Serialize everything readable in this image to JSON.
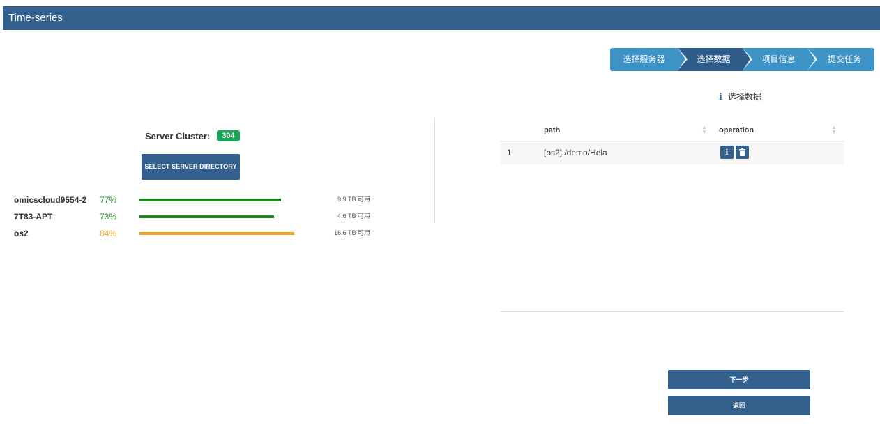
{
  "window": {
    "title": "Time-series"
  },
  "steps": [
    {
      "label": "选择服务器",
      "active": false
    },
    {
      "label": "选择数据",
      "active": true
    },
    {
      "label": "项目信息",
      "active": false
    },
    {
      "label": "提交任务",
      "active": false
    }
  ],
  "hint": {
    "icon": "info-icon",
    "text": "选择数据"
  },
  "cluster": {
    "label": "Server Cluster:",
    "count": "304",
    "badge_color": "#18a55a"
  },
  "select_button": {
    "label": "SELECT SERVER DIRECTORY"
  },
  "servers": [
    {
      "name": "omicscloud9554-2",
      "percent": "77%",
      "usage": 0.77,
      "available": "9.9 TB 可用",
      "color": "#1a8a1a"
    },
    {
      "name": "7T83-APT",
      "percent": "73%",
      "usage": 0.73,
      "available": "4.6 TB 可用",
      "color": "#1a8a1a"
    },
    {
      "name": "os2",
      "percent": "84%",
      "usage": 0.84,
      "available": "16.6 TB 可用",
      "color": "#f5a623"
    }
  ],
  "table": {
    "columns": [
      "path",
      "operation"
    ],
    "rows": [
      {
        "index": "1",
        "path": "[os2] /demo/Hela"
      }
    ]
  },
  "buttons": {
    "next": "下一步",
    "back": "返回"
  },
  "colors": {
    "primary": "#34608d",
    "step_inactive": "#3d93c6",
    "step_active": "#2f5b89"
  }
}
